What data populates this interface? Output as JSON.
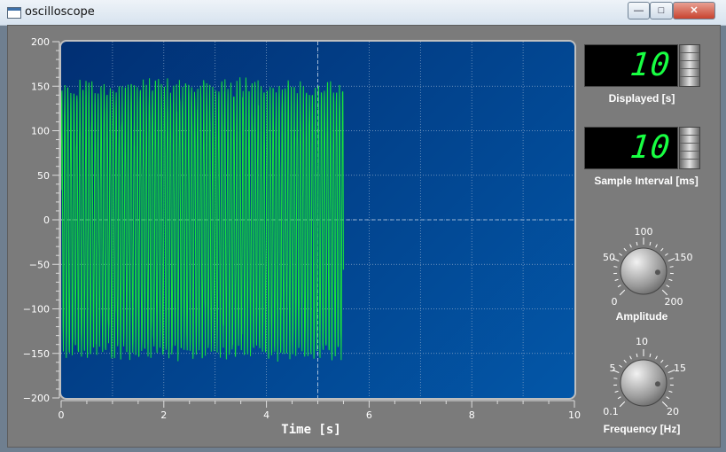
{
  "window": {
    "title": "oscilloscope",
    "controls": {
      "minimize": "—",
      "maximize": "□",
      "close": "✕"
    }
  },
  "plot": {
    "xlabel": "Time [s]",
    "x_ticks": [
      "0",
      "2",
      "4",
      "6",
      "8",
      "10"
    ],
    "y_ticks": [
      "200",
      "150",
      "100",
      "50",
      "0",
      "−50",
      "−100",
      "−150",
      "−200"
    ]
  },
  "controls": {
    "displayed": {
      "value": "10",
      "label": "Displayed [s]"
    },
    "sample_interval": {
      "value": "10",
      "label": "Sample Interval [ms]"
    },
    "amplitude": {
      "label": "Amplitude",
      "scale": [
        "0",
        "50",
        "100",
        "150",
        "200"
      ],
      "value": 170
    },
    "frequency": {
      "label": "Frequency [Hz]",
      "scale": [
        "0.1",
        "5",
        "10",
        "15",
        "20"
      ],
      "value": 17
    }
  },
  "chart_data": {
    "type": "line",
    "xlabel": "Time [s]",
    "ylabel": "",
    "xlim": [
      0,
      10
    ],
    "ylim": [
      -200,
      200
    ],
    "grid": true,
    "cursor_x": 5,
    "series": [
      {
        "color": "#19e33b",
        "t_end": 5.5,
        "amplitude_max": 160,
        "frequency_hz": 17
      }
    ],
    "colors": {
      "signal": "#19e33b",
      "plot_bg": "#02438d",
      "grid": "#8aa7c9"
    }
  }
}
